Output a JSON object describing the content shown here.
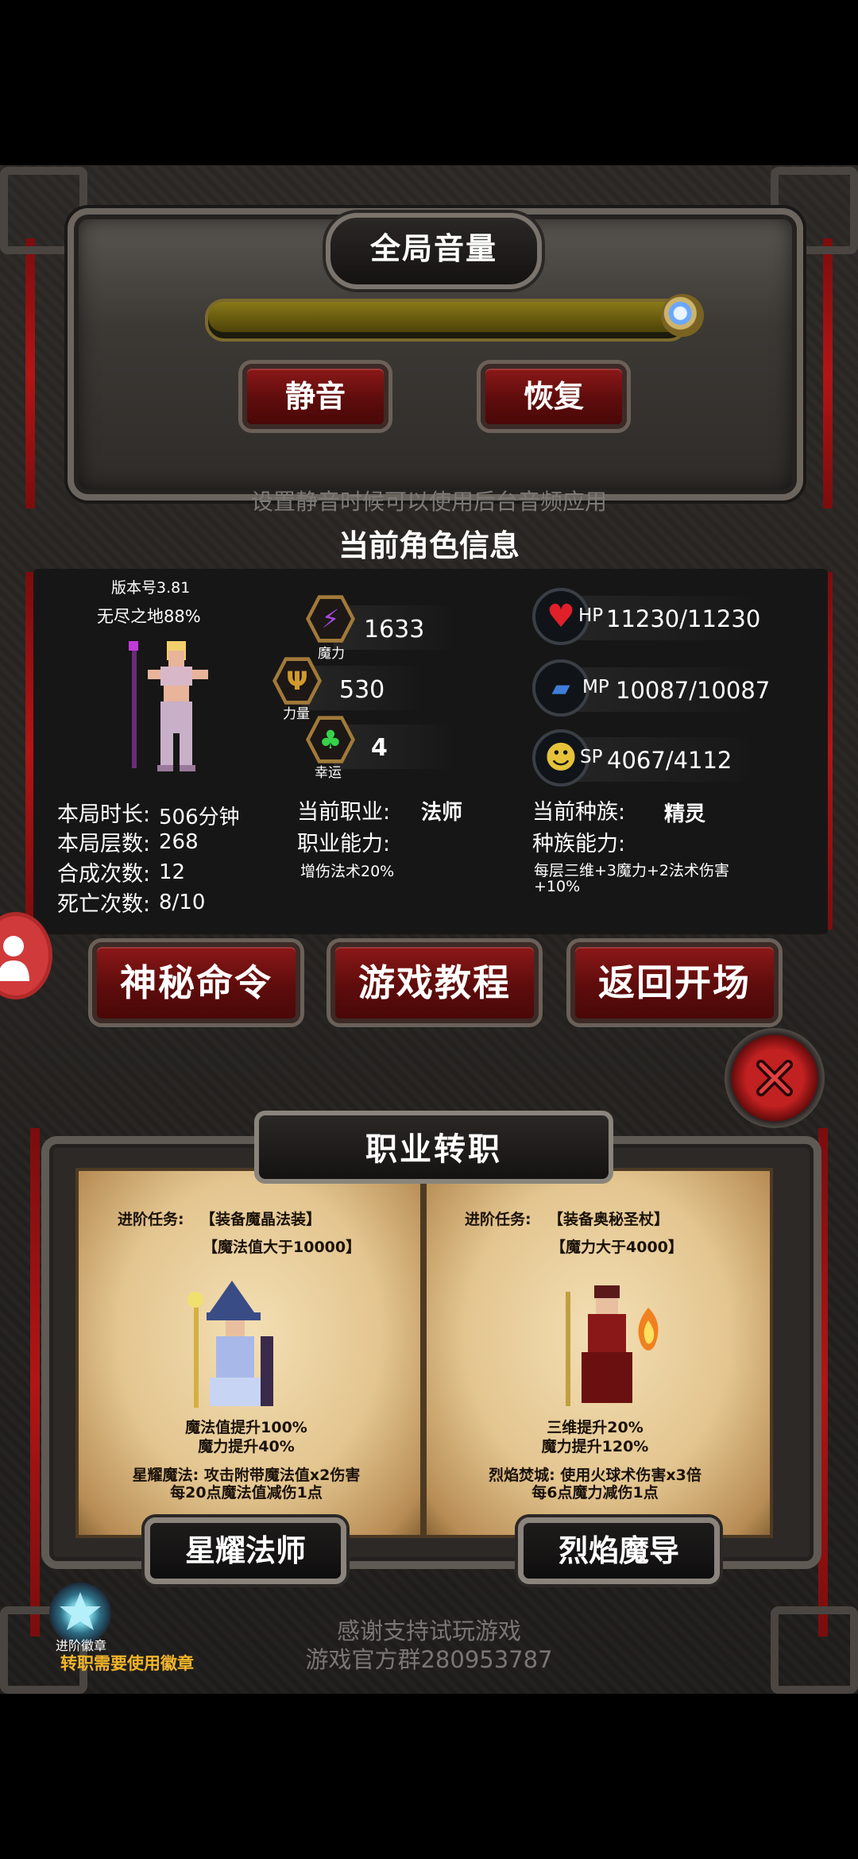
{
  "volume": {
    "title": "全局音量",
    "level_percent": 100,
    "mute_label": "静音",
    "restore_label": "恢复",
    "hint": "设置静音时候可以使用后台音频应用"
  },
  "character": {
    "title": "当前角色信息",
    "version": "版本号3.81",
    "endless": "无尽之地88%",
    "stats": {
      "magic": {
        "value": "1633",
        "caption": "魔力",
        "color": "#a54be0"
      },
      "strength": {
        "value": "530",
        "caption": "力量",
        "color": "#d19a2c"
      },
      "luck": {
        "value": "4",
        "caption": "幸运",
        "color": "#36d24a"
      }
    },
    "vitals": {
      "hp": {
        "label": "HP",
        "value": "11230/11230",
        "color": "#e0202a"
      },
      "mp": {
        "label": "MP",
        "value": "10087/10087",
        "color": "#3e7ed8"
      },
      "sp": {
        "label": "SP",
        "value": "4067/4112",
        "color": "#e5c23a"
      }
    },
    "run": {
      "duration_label": "本局时长:",
      "duration_value": "506分钟",
      "floors_label": "本局层数:",
      "floors_value": "268",
      "merges_label": "合成次数:",
      "merges_value": "12",
      "deaths_label": "死亡次数:",
      "deaths_value": "8/10"
    },
    "job": {
      "label": "当前职业:",
      "value": "法师",
      "ability_label": "职业能力:",
      "ability_value": "增伤法术20%"
    },
    "race": {
      "label": "当前种族:",
      "value": "精灵",
      "ability_label": "种族能力:",
      "ability_value": "每层三维+3魔力+2法术伤害+10%"
    }
  },
  "actions": {
    "secret": "神秘命令",
    "tutorial": "游戏教程",
    "back": "返回开场"
  },
  "class_change": {
    "title": "职业转职",
    "left": {
      "task_label": "进阶任务:",
      "task1": "【装备魔晶法装】",
      "task2": "【魔法值大于10000】",
      "bonus1": "魔法值提升100%",
      "bonus2": "魔力提升40%",
      "skill1": "星耀魔法: 攻击附带魔法值x2伤害",
      "skill2": "每20点魔法值减伤1点",
      "name": "星耀法师"
    },
    "right": {
      "task_label": "进阶任务:",
      "task1": "【装备奥秘圣杖】",
      "task2": "【魔力大于4000】",
      "bonus1": "三维提升20%",
      "bonus2": "魔力提升120%",
      "skill1": "烈焰焚城: 使用火球术伤害x3倍",
      "skill2": "每6点魔力减伤1点",
      "name": "烈焰魔导"
    }
  },
  "badge": {
    "label": "进阶徽章",
    "note": "转职需要使用徽章"
  },
  "footer": {
    "line1": "感谢支持试玩游戏",
    "line2": "游戏官方群280953787"
  }
}
